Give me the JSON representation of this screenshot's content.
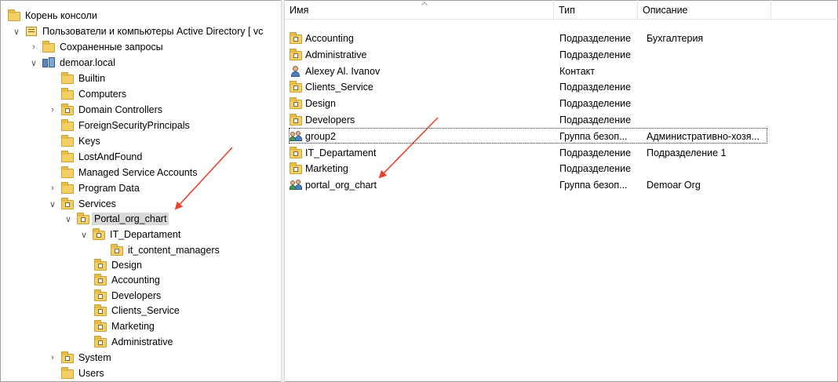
{
  "tree": {
    "root": "Корень консоли",
    "aduc": "Пользователи и компьютеры Active Directory [ vc",
    "saved_queries": "Сохраненные запросы",
    "domain": "demoar.local",
    "builtin": "Builtin",
    "computers": "Computers",
    "domain_controllers": "Domain Controllers",
    "fsp": "ForeignSecurityPrincipals",
    "keys": "Keys",
    "lostandfound": "LostAndFound",
    "msa": "Managed Service Accounts",
    "program_data": "Program Data",
    "services": "Services",
    "portal_org_chart": "Portal_org_chart",
    "it_departament": "IT_Departament",
    "it_content_managers": "it_content_managers",
    "design": "Design",
    "accounting": "Accounting",
    "developers": "Developers",
    "clients_service": "Clients_Service",
    "marketing": "Marketing",
    "administrative": "Administrative",
    "system": "System",
    "users": "Users"
  },
  "list": {
    "headers": {
      "name": "Имя",
      "type": "Тип",
      "description": "Описание"
    },
    "rows": [
      {
        "name": "Accounting",
        "type": "Подразделение",
        "description": "Бухгалтерия",
        "icon": "ou-icon"
      },
      {
        "name": "Administrative",
        "type": "Подразделение",
        "description": "",
        "icon": "ou-icon"
      },
      {
        "name": "Alexey Al. Ivanov",
        "type": "Контакт",
        "description": "",
        "icon": "contact-icon"
      },
      {
        "name": "Clients_Service",
        "type": "Подразделение",
        "description": "",
        "icon": "ou-icon"
      },
      {
        "name": "Design",
        "type": "Подразделение",
        "description": "",
        "icon": "ou-icon"
      },
      {
        "name": "Developers",
        "type": "Подразделение",
        "description": "",
        "icon": "ou-icon"
      },
      {
        "name": "group2",
        "type": "Группа безоп...",
        "description": "Административно-хозя...",
        "icon": "group-icon"
      },
      {
        "name": "IT_Departament",
        "type": "Подразделение",
        "description": "Подразделение 1",
        "icon": "ou-icon"
      },
      {
        "name": "Marketing",
        "type": "Подразделение",
        "description": "",
        "icon": "ou-icon"
      },
      {
        "name": "portal_org_chart",
        "type": "Группа безоп...",
        "description": "Demoar Org",
        "icon": "group-icon"
      }
    ]
  },
  "colors": {
    "annotation_arrow": "#e8402a",
    "selection": "#d9d9d9"
  }
}
